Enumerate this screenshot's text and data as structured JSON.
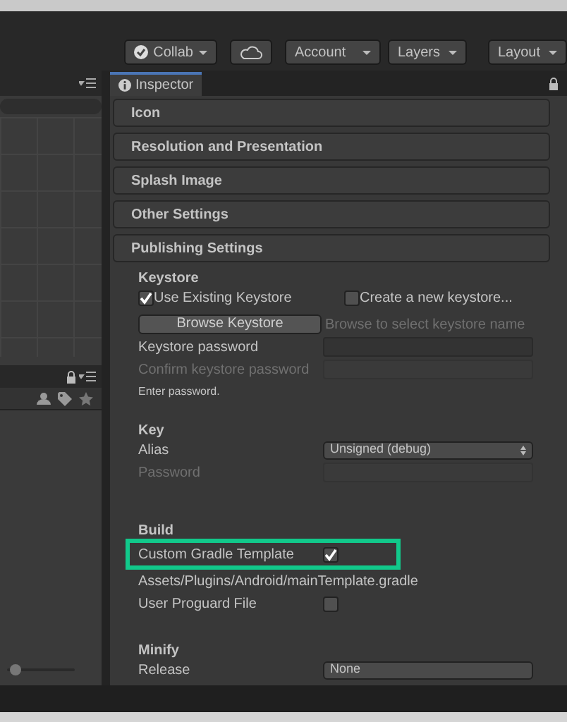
{
  "scene_panel": {
    "zoom_slider": {
      "level": 0.05
    }
  },
  "toolbar": {
    "buttons": [
      {
        "kind": "collab",
        "label": "Collab"
      },
      {
        "kind": "cloud"
      },
      {
        "kind": "dropdown",
        "label": "Account"
      },
      {
        "kind": "dropdown",
        "label": "Layers"
      },
      {
        "kind": "dropdown",
        "label": "Layout"
      }
    ]
  },
  "inspector": {
    "tab": "Inspector",
    "sections": [
      {
        "title": "Icon"
      },
      {
        "title": "Resolution and Presentation"
      },
      {
        "title": "Splash Image"
      },
      {
        "title": "Other Settings"
      },
      {
        "title": "Publishing Settings"
      }
    ]
  },
  "keystore": {
    "heading": "Keystore",
    "options": [
      {
        "label": "Use Existing Keystore",
        "checked": true
      },
      {
        "label": "Create a new keystore...",
        "checked": false
      }
    ],
    "browse_button": "Browse Keystore",
    "browse_hint": "Browse to select keystore name",
    "fields": [
      {
        "label": "Keystore password",
        "disabled": false
      },
      {
        "label": "Confirm keystore password",
        "disabled": true
      }
    ],
    "message": "Enter password."
  },
  "key": {
    "heading": "Key",
    "alias_label": "Alias",
    "alias_value": "Unsigned (debug)",
    "fields": [
      {
        "label": "Password",
        "disabled": true
      }
    ]
  },
  "build": {
    "heading": "Build",
    "rows": [
      {
        "kind": "checkbox",
        "label": "Custom Gradle Template",
        "checked": true,
        "highlighted": true
      },
      {
        "kind": "path",
        "label": "Assets/Plugins/Android/mainTemplate.gradle"
      },
      {
        "kind": "checkbox",
        "label": "User Proguard File",
        "checked": false,
        "highlighted": false
      }
    ]
  },
  "minify": {
    "heading": "Minify",
    "release_label": "Release",
    "release_value": "None"
  }
}
